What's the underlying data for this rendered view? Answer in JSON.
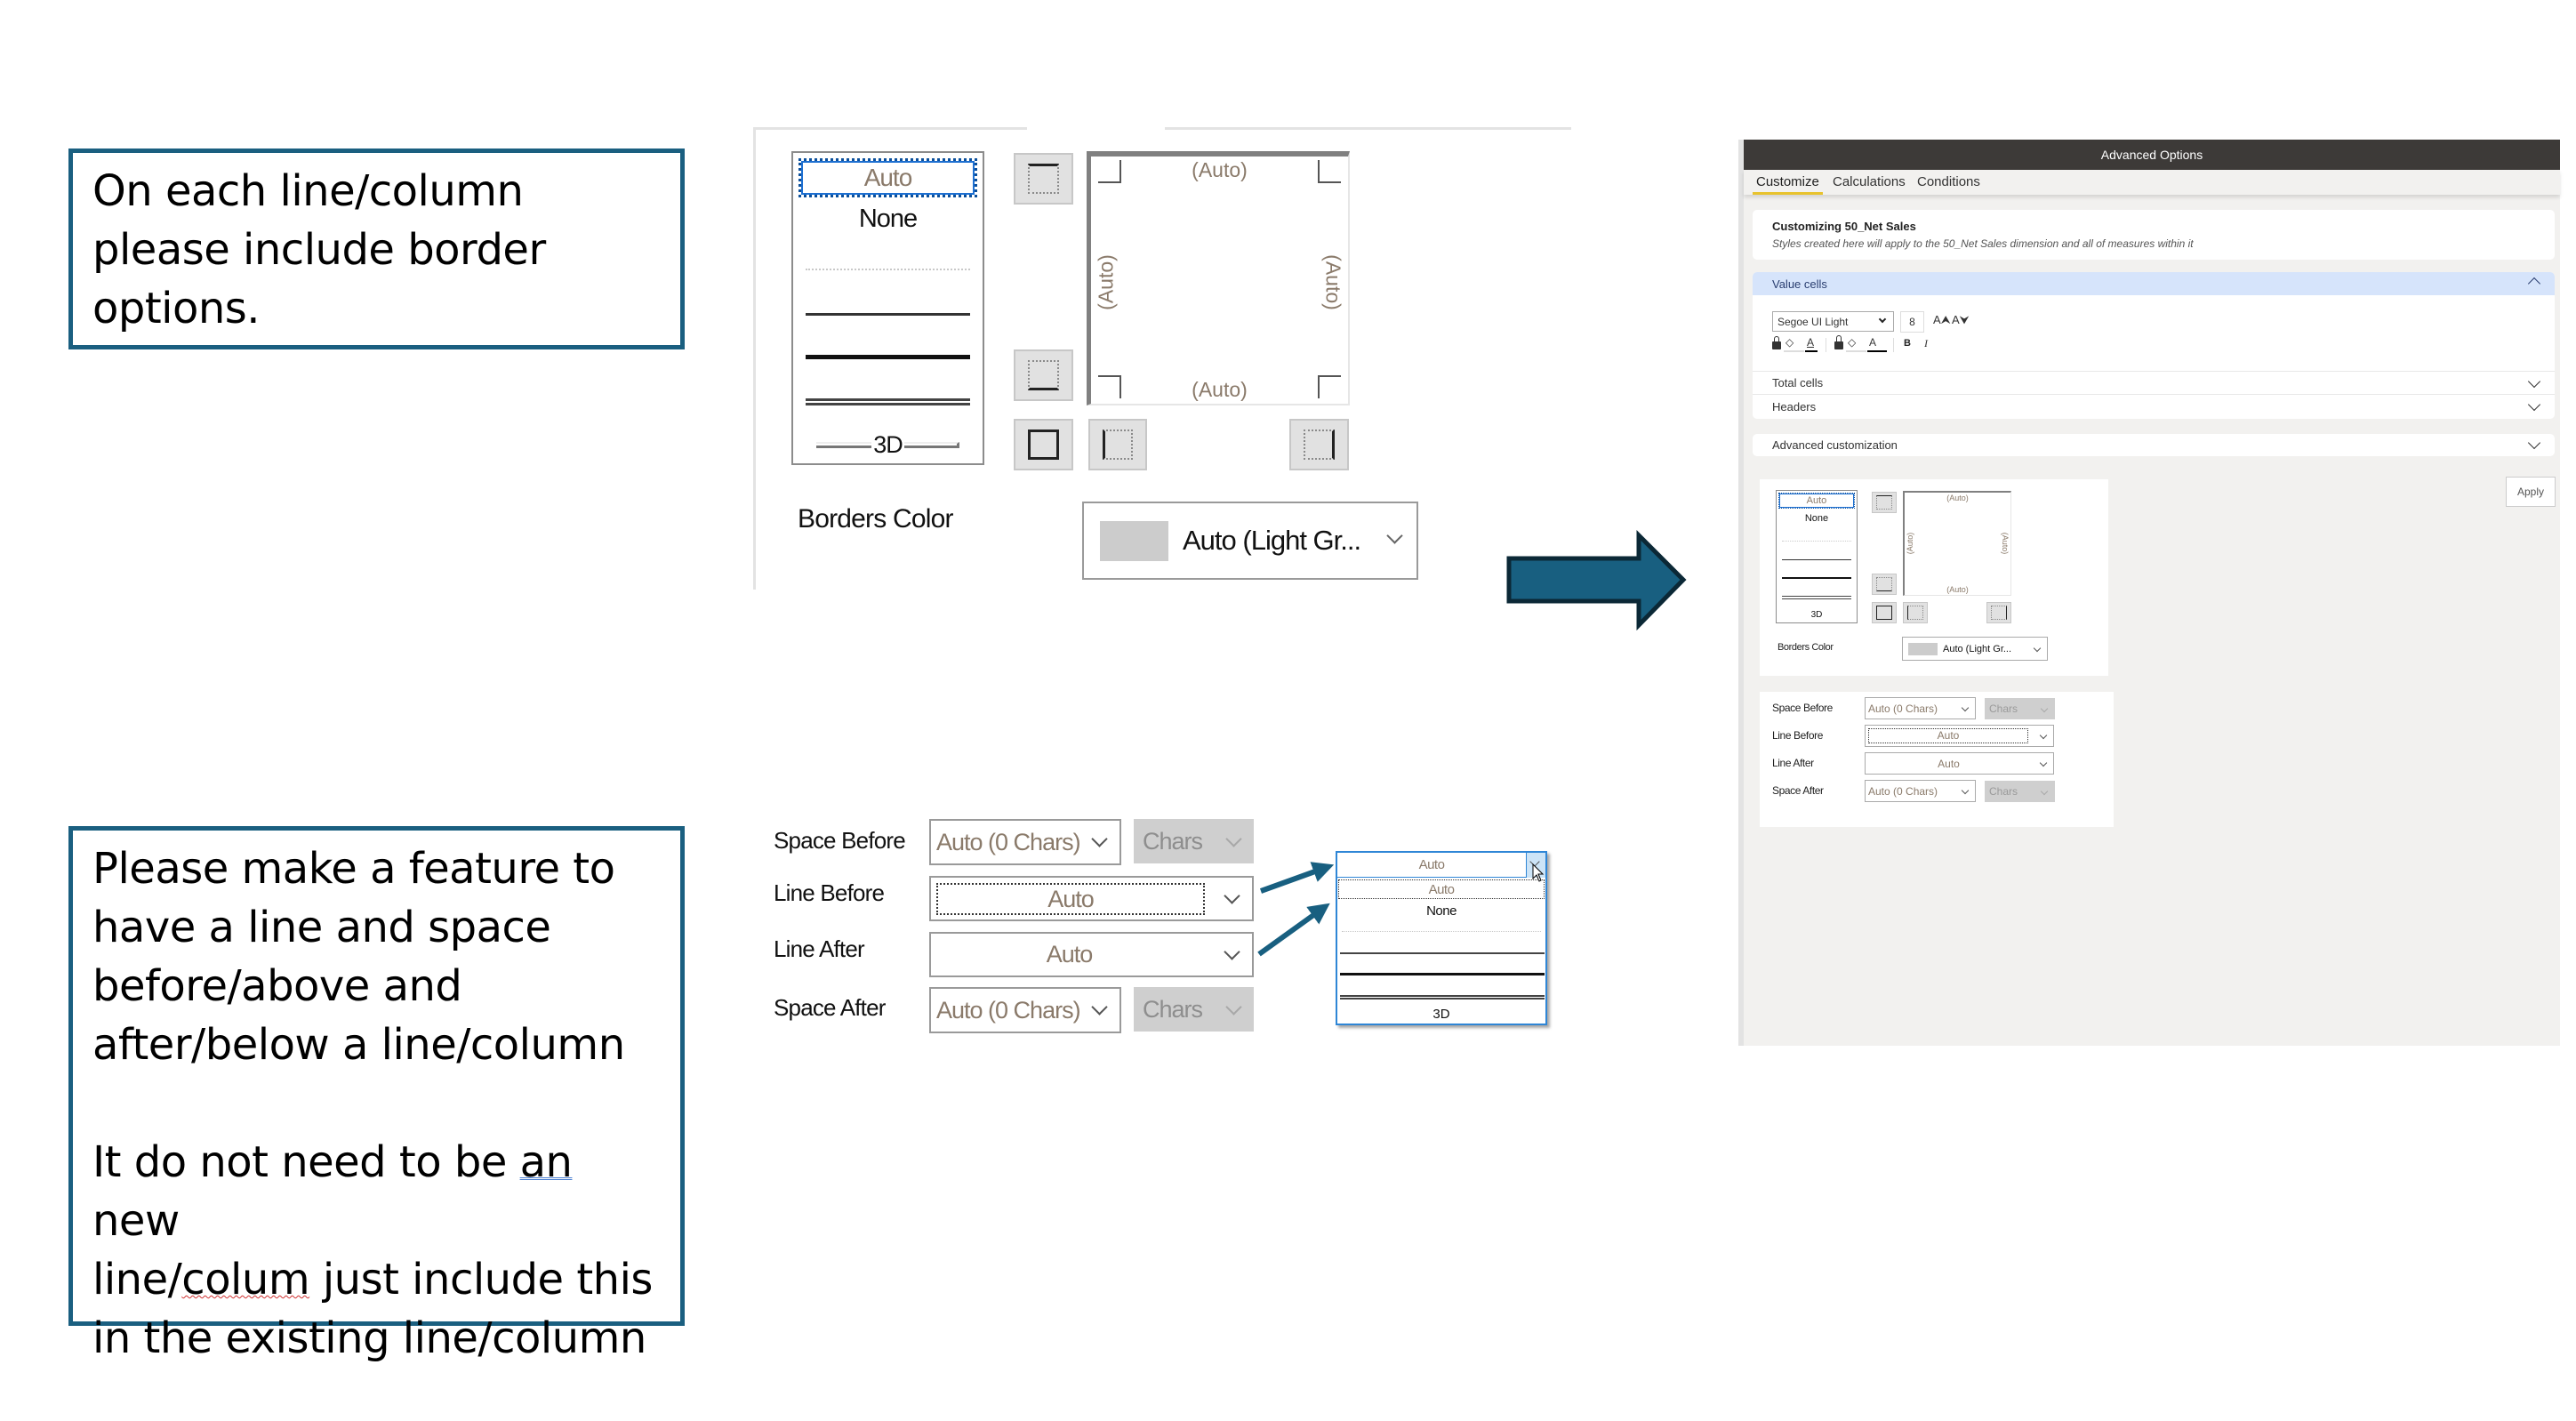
{
  "notes": {
    "border_request": "On each line/column\nplease include border\noptions.",
    "line_space_request_p1": "Please make a feature to\nhave a line and space\nbefore/above and\nafter/below a line/column",
    "line_space_request_p2_a": "It do not need to be ",
    "line_space_request_p2_an": "an",
    "line_space_request_p2_b": " new\nline/",
    "line_space_request_p2_colum": "colum",
    "line_space_request_p2_c": " just include this\nin the existing line/column"
  },
  "border_dialog": {
    "style_list": {
      "items": [
        "Auto",
        "None",
        "dotted",
        "thin",
        "thick",
        "double",
        "3D"
      ],
      "selected": "Auto",
      "auto_label": "Auto",
      "none_label": "None",
      "threed_label": "3D"
    },
    "preview": {
      "top_label": "(Auto)",
      "bottom_label": "(Auto)",
      "left_label": "(Auto)",
      "right_label": "(Auto)"
    },
    "buttons": [
      "top-border",
      "bottom-border",
      "outline-border",
      "left-border",
      "right-border"
    ],
    "borders_color_label": "Borders Color",
    "borders_color_value": "Auto (Light Gr...",
    "borders_color_swatch": "#cccccc"
  },
  "spacing_dialog": {
    "space_before_label": "Space Before",
    "space_before_value": "Auto (0 Chars)",
    "space_before_unit": "Chars",
    "line_before_label": "Line Before",
    "line_before_value": "Auto",
    "line_after_label": "Line After",
    "line_after_value": "Auto",
    "space_after_label": "Space After",
    "space_after_value": "Auto (0 Chars)",
    "space_after_unit": "Chars"
  },
  "line_dropdown": {
    "current": "Auto",
    "options": [
      "Auto",
      "None",
      "dotted",
      "thin",
      "thick",
      "double",
      "3D"
    ],
    "auto_label": "Auto",
    "none_label": "None",
    "threed_label": "3D"
  },
  "advanced_options": {
    "title": "Advanced Options",
    "tabs": [
      {
        "label": "Customize",
        "active": true
      },
      {
        "label": "Calculations",
        "active": false
      },
      {
        "label": "Conditions",
        "active": false
      }
    ],
    "info_title": "Customizing 50_Net Sales",
    "info_subtitle": "Styles created here will apply to the 50_Net Sales dimension and all of measures within it",
    "sections": {
      "value_cells": "Value cells",
      "total_cells": "Total cells",
      "headers": "Headers",
      "advanced_customization": "Advanced customization"
    },
    "font_family": "Segoe UI Light",
    "font_size": "8",
    "bold_label": "B",
    "italic_label": "I",
    "apply_label": "Apply"
  },
  "colors": {
    "accent": "#1a5f80",
    "tab_underline": "#e8c22c",
    "section_highlight": "#d6e4fb",
    "panel_header": "#3d3a38",
    "panel_bg": "#f2f1ef"
  }
}
